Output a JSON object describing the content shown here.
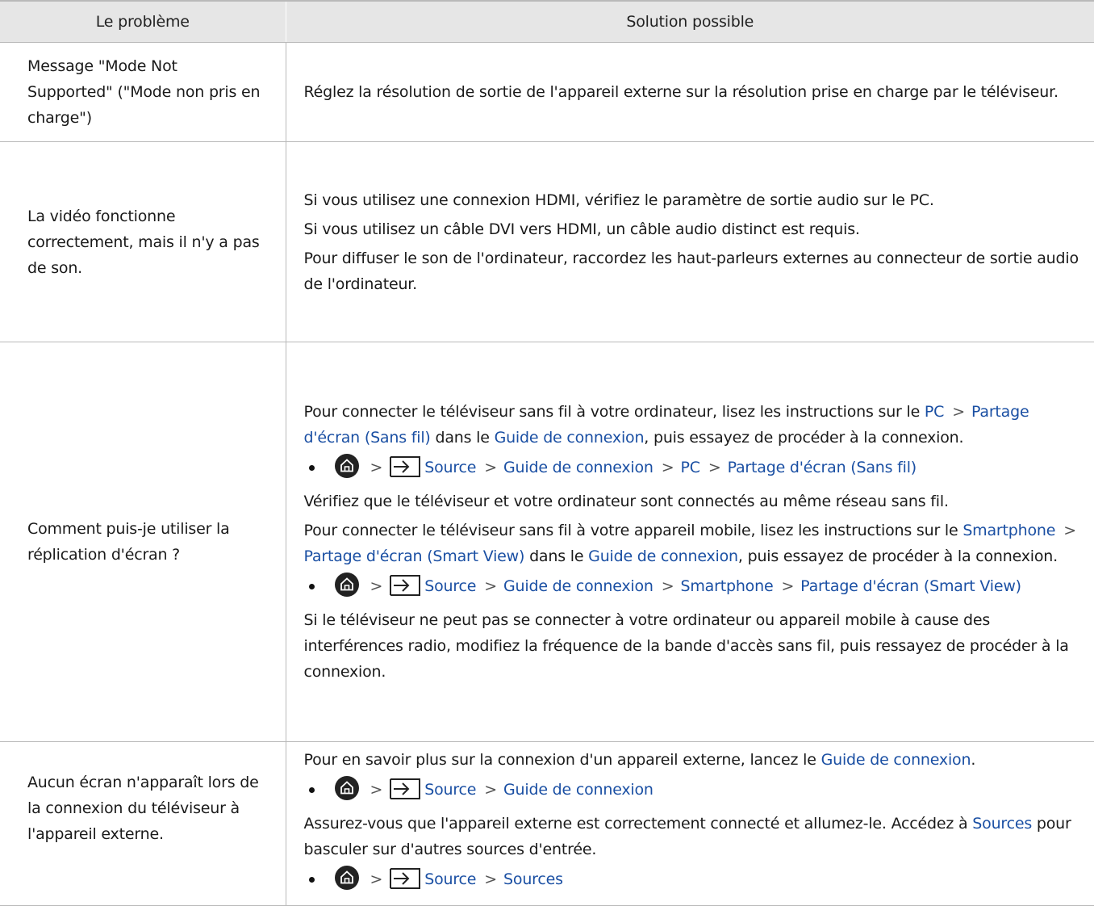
{
  "header": {
    "col1": "Le problème",
    "col2": "Solution possible"
  },
  "rows": [
    {
      "problem": "Message \"Mode Not Supported\" (\"Mode non pris en charge\")",
      "solution": "Réglez la résolution de sortie de l'appareil externe sur la résolution prise en charge par le téléviseur."
    },
    {
      "problem": "La vidéo fonctionne correctement, mais il n'y a pas de son.",
      "p1": "Si vous utilisez une connexion HDMI, vérifiez le paramètre de sortie audio sur le PC.",
      "p2": "Si vous utilisez un câble DVI vers HDMI, un câble audio distinct est requis.",
      "p3": "Pour diffuser le son de l'ordinateur, raccordez les haut-parleurs externes au connecteur de sortie audio de l'ordinateur."
    },
    {
      "problem": "Comment puis-je utiliser la réplication d'écran ?",
      "p1_a": "Pour connecter le téléviseur sans fil à votre ordinateur, lisez les instructions sur le ",
      "p1_link1": "PC",
      "p1_link2": "Partage d'écran (Sans fil)",
      "p1_b": " dans le ",
      "p1_link3": "Guide de connexion",
      "p1_c": ", puis essayez de procéder à la connexion.",
      "path1": [
        "Source",
        "Guide de connexion",
        "PC",
        "Partage d'écran (Sans fil)"
      ],
      "p2": "Vérifiez que le téléviseur et votre ordinateur sont connectés au même réseau sans fil.",
      "p3_a": "Pour connecter le téléviseur sans fil à votre appareil mobile, lisez les instructions sur le ",
      "p3_link1": "Smartphone",
      "p3_link2": "Partage d'écran (Smart View)",
      "p3_b": " dans le ",
      "p3_link3": "Guide de connexion",
      "p3_c": ", puis essayez de procéder à la connexion.",
      "path2": [
        "Source",
        "Guide de connexion",
        "Smartphone",
        "Partage d'écran (Smart View)"
      ],
      "p4": "Si le téléviseur ne peut pas se connecter à votre ordinateur ou appareil mobile à cause des interférences radio, modifiez la fréquence de la bande d'accès sans fil, puis ressayez de procéder à la connexion."
    },
    {
      "problem": "Aucun écran n'apparaît lors de la connexion du téléviseur à l'appareil externe.",
      "p1_a": "Pour en savoir plus sur la connexion d'un appareil externe, lancez le ",
      "p1_link": "Guide de connexion",
      "p1_b": ".",
      "path1": [
        "Source",
        "Guide de connexion"
      ],
      "p2_a": "Assurez-vous que l'appareil externe est correctement connecté et allumez-le. Accédez à ",
      "p2_link": "Sources",
      "p2_b": " pour basculer sur d'autres sources d'entrée.",
      "path2": [
        "Source",
        "Sources"
      ]
    }
  ],
  "icons": {
    "home": "home-icon",
    "source": "source-input-icon",
    "chevron": "chevron-right-icon"
  },
  "colors": {
    "link": "#1a4fa3",
    "header_bg": "#e6e6e6",
    "border": "#b9b9b9"
  }
}
